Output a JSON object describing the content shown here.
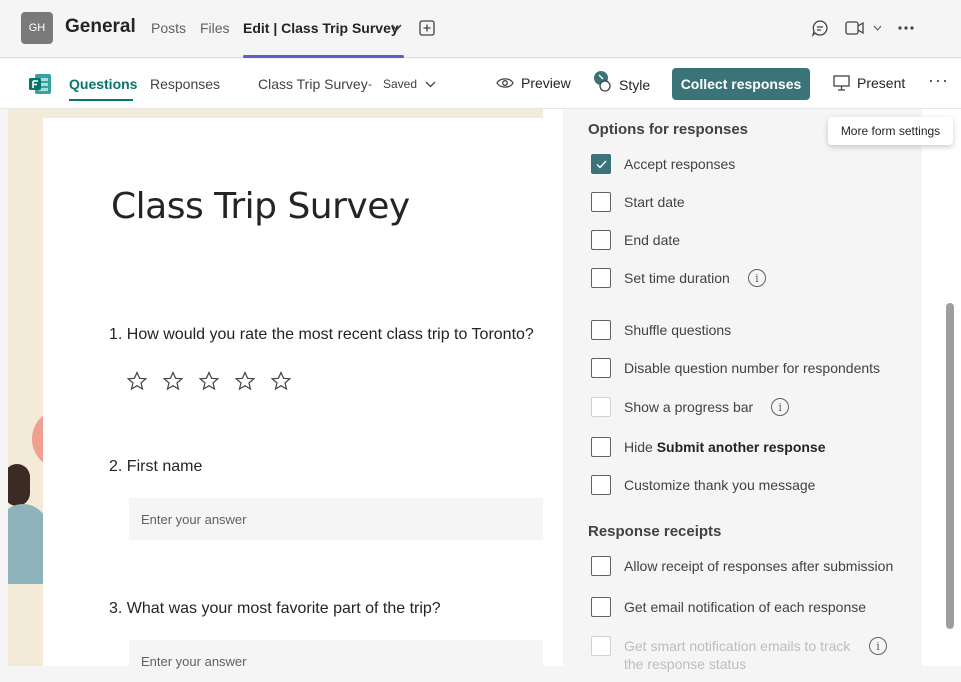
{
  "topbar": {
    "avatar_initials": "GH",
    "channel_name": "General",
    "tabs": [
      {
        "label": "Posts"
      },
      {
        "label": "Files"
      },
      {
        "label": "Edit | Class Trip Survey"
      }
    ]
  },
  "subbar": {
    "tabs": [
      {
        "label": "Questions"
      },
      {
        "label": "Responses"
      }
    ],
    "form_name": "Class Trip Survey",
    "separator": "-",
    "saved_label": "Saved",
    "preview_label": "Preview",
    "style_label": "Style",
    "collect_label": "Collect responses",
    "present_label": "Present",
    "more_label": "···"
  },
  "tooltip": {
    "text": "More form settings"
  },
  "form": {
    "title": "Class Trip Survey",
    "questions": [
      {
        "text": "1. How would you rate the most recent class trip to Toronto?",
        "rating_stars": 5
      },
      {
        "text": "2. First name",
        "placeholder": "Enter your answer"
      },
      {
        "text": "3. What was your most favorite part of the trip?",
        "placeholder": "Enter your answer"
      }
    ]
  },
  "settings": {
    "options_heading": "Options for responses",
    "options": [
      {
        "label": "Accept responses",
        "checked": true
      },
      {
        "label": "Start date",
        "checked": false
      },
      {
        "label": "End date",
        "checked": false
      },
      {
        "label": "Set time duration",
        "checked": false,
        "info": true
      },
      {
        "label": "Shuffle questions",
        "checked": false
      },
      {
        "label": "Disable question number for respondents",
        "checked": false
      },
      {
        "label": "Show a progress bar",
        "checked": false,
        "info": true,
        "disabled": true
      },
      {
        "label_prefix": "Hide ",
        "label_bold": "Submit another response",
        "checked": false
      },
      {
        "label": "Customize thank you message",
        "checked": false
      }
    ],
    "receipts_heading": "Response receipts",
    "receipts": [
      {
        "label": "Allow receipt of responses after submission",
        "checked": false
      },
      {
        "label": "Get email notification of each response",
        "checked": false
      },
      {
        "label": "Get smart notification emails to track the response status",
        "checked": false,
        "info": true,
        "disabled": true
      }
    ]
  },
  "colors": {
    "accent": "#3a7479",
    "teal_tab": "#077568",
    "teams_purple": "#5b5fc7"
  }
}
